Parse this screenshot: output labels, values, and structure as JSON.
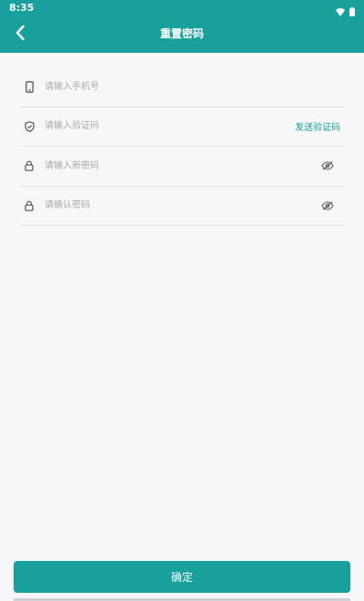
{
  "status_bar": {
    "time": "8:35",
    "icons": [
      "wifi-icon",
      "battery-icon"
    ]
  },
  "header": {
    "title": "重置密码",
    "back_icon": "chevron-left-icon"
  },
  "form": {
    "phone": {
      "placeholder": "请输入手机号",
      "value": "",
      "icon": "phone-icon"
    },
    "code": {
      "placeholder": "请输入验证码",
      "value": "",
      "icon": "shield-icon",
      "send_label": "发送验证码"
    },
    "new_password": {
      "placeholder": "请输入新密码",
      "value": "",
      "icon": "lock-icon",
      "toggle_icon": "eye-closed-icon"
    },
    "confirm_password": {
      "placeholder": "请确认密码",
      "value": "",
      "icon": "lock-icon",
      "toggle_icon": "eye-closed-icon"
    }
  },
  "actions": {
    "confirm_label": "确定"
  },
  "colors": {
    "accent": "#17a09c",
    "background": "#f7f7f9",
    "divider": "#e2e2e6",
    "placeholder": "#a9a9b0"
  }
}
